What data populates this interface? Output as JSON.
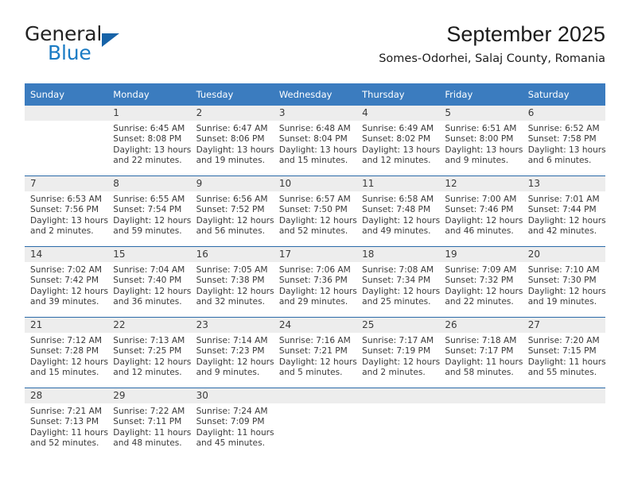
{
  "branding": {
    "logo_primary": "General",
    "logo_secondary": "Blue",
    "logo_triangle_color": "#1763a8",
    "logo_blue_color": "#1a7bc4"
  },
  "header": {
    "title": "September 2025",
    "location": "Somes-Odorhei, Salaj County, Romania"
  },
  "theme": {
    "header_row_bg": "#3b7cbf",
    "header_row_text": "#ffffff",
    "daynum_bg": "#ededed",
    "row_divider": "#2a6aa8"
  },
  "calendar": {
    "weekday_headers": [
      "Sunday",
      "Monday",
      "Tuesday",
      "Wednesday",
      "Thursday",
      "Friday",
      "Saturday"
    ],
    "weeks": [
      [
        {
          "day": "",
          "sunrise": "",
          "sunset": "",
          "daylight_line1": "",
          "daylight_line2": ""
        },
        {
          "day": "1",
          "sunrise": "Sunrise: 6:45 AM",
          "sunset": "Sunset: 8:08 PM",
          "daylight_line1": "Daylight: 13 hours",
          "daylight_line2": "and 22 minutes."
        },
        {
          "day": "2",
          "sunrise": "Sunrise: 6:47 AM",
          "sunset": "Sunset: 8:06 PM",
          "daylight_line1": "Daylight: 13 hours",
          "daylight_line2": "and 19 minutes."
        },
        {
          "day": "3",
          "sunrise": "Sunrise: 6:48 AM",
          "sunset": "Sunset: 8:04 PM",
          "daylight_line1": "Daylight: 13 hours",
          "daylight_line2": "and 15 minutes."
        },
        {
          "day": "4",
          "sunrise": "Sunrise: 6:49 AM",
          "sunset": "Sunset: 8:02 PM",
          "daylight_line1": "Daylight: 13 hours",
          "daylight_line2": "and 12 minutes."
        },
        {
          "day": "5",
          "sunrise": "Sunrise: 6:51 AM",
          "sunset": "Sunset: 8:00 PM",
          "daylight_line1": "Daylight: 13 hours",
          "daylight_line2": "and 9 minutes."
        },
        {
          "day": "6",
          "sunrise": "Sunrise: 6:52 AM",
          "sunset": "Sunset: 7:58 PM",
          "daylight_line1": "Daylight: 13 hours",
          "daylight_line2": "and 6 minutes."
        }
      ],
      [
        {
          "day": "7",
          "sunrise": "Sunrise: 6:53 AM",
          "sunset": "Sunset: 7:56 PM",
          "daylight_line1": "Daylight: 13 hours",
          "daylight_line2": "and 2 minutes."
        },
        {
          "day": "8",
          "sunrise": "Sunrise: 6:55 AM",
          "sunset": "Sunset: 7:54 PM",
          "daylight_line1": "Daylight: 12 hours",
          "daylight_line2": "and 59 minutes."
        },
        {
          "day": "9",
          "sunrise": "Sunrise: 6:56 AM",
          "sunset": "Sunset: 7:52 PM",
          "daylight_line1": "Daylight: 12 hours",
          "daylight_line2": "and 56 minutes."
        },
        {
          "day": "10",
          "sunrise": "Sunrise: 6:57 AM",
          "sunset": "Sunset: 7:50 PM",
          "daylight_line1": "Daylight: 12 hours",
          "daylight_line2": "and 52 minutes."
        },
        {
          "day": "11",
          "sunrise": "Sunrise: 6:58 AM",
          "sunset": "Sunset: 7:48 PM",
          "daylight_line1": "Daylight: 12 hours",
          "daylight_line2": "and 49 minutes."
        },
        {
          "day": "12",
          "sunrise": "Sunrise: 7:00 AM",
          "sunset": "Sunset: 7:46 PM",
          "daylight_line1": "Daylight: 12 hours",
          "daylight_line2": "and 46 minutes."
        },
        {
          "day": "13",
          "sunrise": "Sunrise: 7:01 AM",
          "sunset": "Sunset: 7:44 PM",
          "daylight_line1": "Daylight: 12 hours",
          "daylight_line2": "and 42 minutes."
        }
      ],
      [
        {
          "day": "14",
          "sunrise": "Sunrise: 7:02 AM",
          "sunset": "Sunset: 7:42 PM",
          "daylight_line1": "Daylight: 12 hours",
          "daylight_line2": "and 39 minutes."
        },
        {
          "day": "15",
          "sunrise": "Sunrise: 7:04 AM",
          "sunset": "Sunset: 7:40 PM",
          "daylight_line1": "Daylight: 12 hours",
          "daylight_line2": "and 36 minutes."
        },
        {
          "day": "16",
          "sunrise": "Sunrise: 7:05 AM",
          "sunset": "Sunset: 7:38 PM",
          "daylight_line1": "Daylight: 12 hours",
          "daylight_line2": "and 32 minutes."
        },
        {
          "day": "17",
          "sunrise": "Sunrise: 7:06 AM",
          "sunset": "Sunset: 7:36 PM",
          "daylight_line1": "Daylight: 12 hours",
          "daylight_line2": "and 29 minutes."
        },
        {
          "day": "18",
          "sunrise": "Sunrise: 7:08 AM",
          "sunset": "Sunset: 7:34 PM",
          "daylight_line1": "Daylight: 12 hours",
          "daylight_line2": "and 25 minutes."
        },
        {
          "day": "19",
          "sunrise": "Sunrise: 7:09 AM",
          "sunset": "Sunset: 7:32 PM",
          "daylight_line1": "Daylight: 12 hours",
          "daylight_line2": "and 22 minutes."
        },
        {
          "day": "20",
          "sunrise": "Sunrise: 7:10 AM",
          "sunset": "Sunset: 7:30 PM",
          "daylight_line1": "Daylight: 12 hours",
          "daylight_line2": "and 19 minutes."
        }
      ],
      [
        {
          "day": "21",
          "sunrise": "Sunrise: 7:12 AM",
          "sunset": "Sunset: 7:28 PM",
          "daylight_line1": "Daylight: 12 hours",
          "daylight_line2": "and 15 minutes."
        },
        {
          "day": "22",
          "sunrise": "Sunrise: 7:13 AM",
          "sunset": "Sunset: 7:25 PM",
          "daylight_line1": "Daylight: 12 hours",
          "daylight_line2": "and 12 minutes."
        },
        {
          "day": "23",
          "sunrise": "Sunrise: 7:14 AM",
          "sunset": "Sunset: 7:23 PM",
          "daylight_line1": "Daylight: 12 hours",
          "daylight_line2": "and 9 minutes."
        },
        {
          "day": "24",
          "sunrise": "Sunrise: 7:16 AM",
          "sunset": "Sunset: 7:21 PM",
          "daylight_line1": "Daylight: 12 hours",
          "daylight_line2": "and 5 minutes."
        },
        {
          "day": "25",
          "sunrise": "Sunrise: 7:17 AM",
          "sunset": "Sunset: 7:19 PM",
          "daylight_line1": "Daylight: 12 hours",
          "daylight_line2": "and 2 minutes."
        },
        {
          "day": "26",
          "sunrise": "Sunrise: 7:18 AM",
          "sunset": "Sunset: 7:17 PM",
          "daylight_line1": "Daylight: 11 hours",
          "daylight_line2": "and 58 minutes."
        },
        {
          "day": "27",
          "sunrise": "Sunrise: 7:20 AM",
          "sunset": "Sunset: 7:15 PM",
          "daylight_line1": "Daylight: 11 hours",
          "daylight_line2": "and 55 minutes."
        }
      ],
      [
        {
          "day": "28",
          "sunrise": "Sunrise: 7:21 AM",
          "sunset": "Sunset: 7:13 PM",
          "daylight_line1": "Daylight: 11 hours",
          "daylight_line2": "and 52 minutes."
        },
        {
          "day": "29",
          "sunrise": "Sunrise: 7:22 AM",
          "sunset": "Sunset: 7:11 PM",
          "daylight_line1": "Daylight: 11 hours",
          "daylight_line2": "and 48 minutes."
        },
        {
          "day": "30",
          "sunrise": "Sunrise: 7:24 AM",
          "sunset": "Sunset: 7:09 PM",
          "daylight_line1": "Daylight: 11 hours",
          "daylight_line2": "and 45 minutes."
        },
        {
          "day": "",
          "sunrise": "",
          "sunset": "",
          "daylight_line1": "",
          "daylight_line2": ""
        },
        {
          "day": "",
          "sunrise": "",
          "sunset": "",
          "daylight_line1": "",
          "daylight_line2": ""
        },
        {
          "day": "",
          "sunrise": "",
          "sunset": "",
          "daylight_line1": "",
          "daylight_line2": ""
        },
        {
          "day": "",
          "sunrise": "",
          "sunset": "",
          "daylight_line1": "",
          "daylight_line2": ""
        }
      ]
    ]
  }
}
